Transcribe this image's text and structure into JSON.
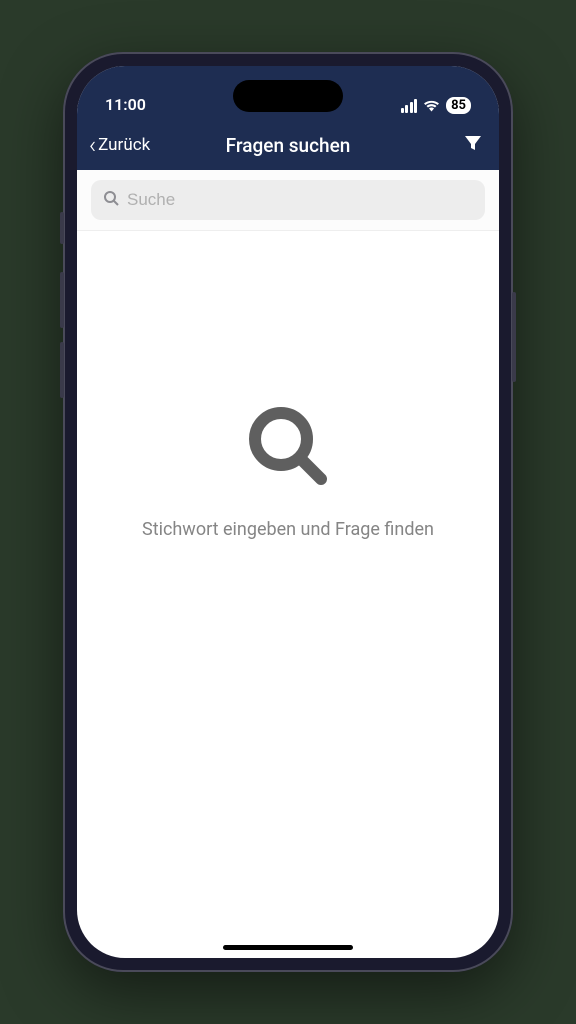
{
  "status": {
    "time": "11:00",
    "battery": "85"
  },
  "nav": {
    "back_label": "Zurück",
    "title": "Fragen suchen"
  },
  "search": {
    "placeholder": "Suche"
  },
  "empty": {
    "message": "Stichwort eingeben und Frage finden"
  },
  "colors": {
    "nav_bg": "#1e2d52",
    "screen_bg": "#ffffff"
  }
}
